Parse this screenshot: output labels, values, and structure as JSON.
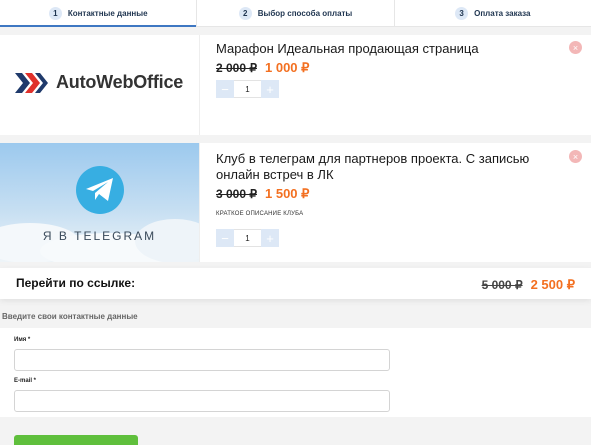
{
  "steps": [
    {
      "num": "1",
      "label": "Контактные данные"
    },
    {
      "num": "2",
      "label": "Выбор способа оплаты"
    },
    {
      "num": "3",
      "label": "Оплата заказа"
    }
  ],
  "products": [
    {
      "logo_text": "AutoWebOffice",
      "title": "Марафон Идеальная продающая страница",
      "old_price": "2 000 ₽",
      "new_price": "1 000 ₽",
      "quantity": "1"
    },
    {
      "image_text": "Я В TELEGRAM",
      "title": "Клуб в телеграм для партнеров проекта. С записью онлайн встреч в ЛК",
      "old_price": "3 000 ₽",
      "new_price": "1 500 ₽",
      "description": "КРАТКОЕ ОПИСАНИЕ КЛУБА",
      "quantity": "1"
    }
  ],
  "stepper": {
    "minus": "−",
    "plus": "+"
  },
  "remove_glyph": "×",
  "total": {
    "label": "Перейти по ссылке:",
    "old_price": "5 000 ₽",
    "new_price": "2 500 ₽"
  },
  "contact": {
    "heading": "Введите свои контактные данные",
    "name_label": "Имя *",
    "name_value": "",
    "email_label": "E-mail *",
    "email_value": ""
  },
  "colors": {
    "accent": "#3e77c2",
    "price_new": "#f37021",
    "submit": "#5fbf3c",
    "telegram": "#37aee2"
  }
}
